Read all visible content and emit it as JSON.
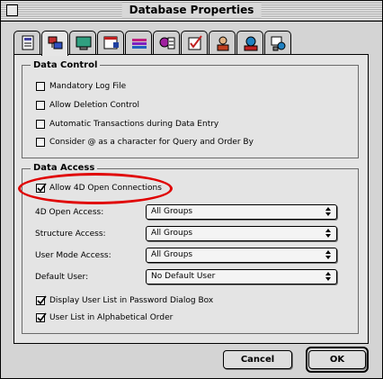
{
  "window": {
    "title": "Database Properties"
  },
  "tabs": [
    {
      "icon": "database-tab-icon"
    },
    {
      "icon": "connections-tab-icon"
    },
    {
      "icon": "display-tab-icon"
    },
    {
      "icon": "window-tab-icon"
    },
    {
      "icon": "style-tab-icon"
    },
    {
      "icon": "menu-tab-icon"
    },
    {
      "icon": "checklist-tab-icon"
    },
    {
      "icon": "user-tab-icon"
    },
    {
      "icon": "plugin-tab-icon"
    },
    {
      "icon": "network-tab-icon"
    }
  ],
  "data_control": {
    "title": "Data Control",
    "items": [
      {
        "label": "Mandatory Log File",
        "checked": false
      },
      {
        "label": "Allow Deletion Control",
        "checked": false
      },
      {
        "label": "Automatic Transactions during Data Entry",
        "checked": false
      },
      {
        "label": "Consider @ as a character for Query and Order By",
        "checked": false
      }
    ]
  },
  "data_access": {
    "title": "Data Access",
    "allow_open": {
      "label": "Allow 4D Open Connections",
      "checked": true
    },
    "fields": [
      {
        "label": "4D Open Access:",
        "value": "All Groups"
      },
      {
        "label": "Structure Access:",
        "value": "All Groups"
      },
      {
        "label": "User Mode Access:",
        "value": "All Groups"
      },
      {
        "label": "Default User:",
        "value": "No Default User"
      }
    ],
    "options": [
      {
        "label": "Display User List in Password Dialog Box",
        "checked": true
      },
      {
        "label": "User List in Alphabetical Order",
        "checked": true
      }
    ]
  },
  "buttons": {
    "cancel": "Cancel",
    "ok": "OK"
  },
  "colors": {
    "highlight_ellipse": "#e00000",
    "window_bg": "#d4d4d4",
    "panel_bg": "#e4e4e4"
  }
}
